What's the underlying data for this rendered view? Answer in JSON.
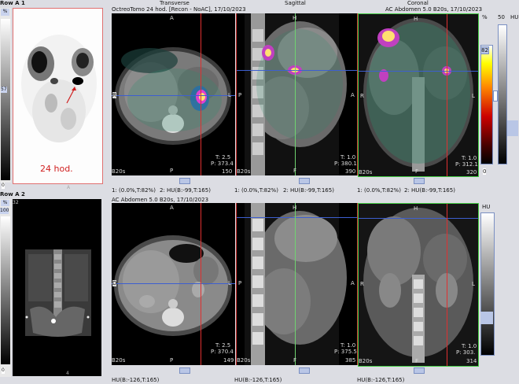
{
  "left": {
    "row1_title": "Row A 1",
    "row2_title": "Row A 2",
    "row1_scale_unit": "%",
    "row1_scale_max": "32",
    "row1_scale_mid": "57",
    "row1_scale_min": "0",
    "row1_annotation": "24 hod.",
    "row1_footer": "A",
    "row2_scale_unit": "%",
    "row2_scale_max": "100",
    "row2_scale_top": "32",
    "row2_scale_min": "0",
    "row2_footer": "4"
  },
  "top": {
    "title_transverse": "Transverse",
    "title_sagittal": "Sagittal",
    "title_coronal": "Coronal",
    "study_left": "OctreoTomo 24 hod. [Recon - NoAC], 17/10/2023",
    "study_right": "AC Abdomen 5.0 B20s, 17/10/2023",
    "transverse": {
      "top": "A",
      "left": "R",
      "right": "L",
      "bottom": "P",
      "t": "T: 2.5",
      "p": "P: 373.4",
      "footer_left": "B20s",
      "footer_right": "150"
    },
    "sagittal": {
      "top": "H",
      "left": "P",
      "right": "A",
      "bottom": "F",
      "t": "T: 1.0",
      "p": "P: 380.1",
      "footer_left": "B20s",
      "footer_right": "390"
    },
    "coronal": {
      "top": "H",
      "left": "R",
      "right": "L",
      "bottom": "F",
      "t": "T: 1.0",
      "p": "P: 312.1",
      "footer_left": "B20s",
      "footer_right": "320"
    },
    "status": [
      "1: (0.0%,T:82%)",
      "2: HU(B:-99,T:165)",
      "1: (0.0%,T:82%)",
      "2: HU(B:-99,T:165)",
      "1: (0.0%,T:82%)",
      "2: HU(B:-99,T:165)"
    ]
  },
  "bottom": {
    "study": "AC Abdomen 5.0 B20s, 17/10/2023",
    "transverse": {
      "top": "A",
      "left": "D",
      "right": "L",
      "bottom": "P",
      "t": "T: 2.5",
      "p": "P: 370.4",
      "footer_left": "B20s",
      "footer_right": "149"
    },
    "sagittal": {
      "top": "H",
      "left": "P",
      "right": "A",
      "bottom": "F",
      "t": "T: 1.0",
      "p": "P: 375.5",
      "footer_left": "B20s",
      "footer_right": "385"
    },
    "coronal": {
      "top": "H",
      "left": "R",
      "right": "L",
      "bottom": "F",
      "t": "T: 1.0",
      "p": "P: 303.",
      "footer_left": "B20s",
      "footer_right": "314"
    },
    "status": [
      "HU(B:-126,T:165)",
      "HU(B:-126,T:165)",
      "HU(B:-126,T:165)"
    ]
  },
  "right_scale": {
    "top_unit": "%",
    "top_max": "50",
    "top_label": "HU",
    "top_value": "82",
    "top_min": "0",
    "bottom_label": "HU"
  },
  "colors": {
    "crosshair_green": "#6fd36f",
    "crosshair_blue": "#3d5fd0",
    "crosshair_red": "#e03030",
    "annotation_red": "#d02020"
  }
}
